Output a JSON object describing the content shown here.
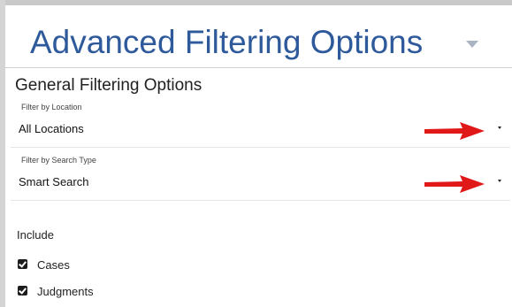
{
  "header": {
    "title": "Advanced Filtering Options",
    "caret_icon": "chevron-down-icon"
  },
  "general": {
    "section_title": "General Filtering Options",
    "location": {
      "label": "Filter by Location",
      "value": "All Locations"
    },
    "search_type": {
      "label": "Filter by Search Type",
      "value": "Smart Search"
    }
  },
  "include": {
    "label": "Include",
    "options": [
      {
        "label": "Cases",
        "checked": true
      },
      {
        "label": "Judgments",
        "checked": true
      }
    ]
  },
  "annotation": {
    "arrow_color": "#e01818"
  },
  "colors": {
    "title": "#2e5a9b"
  }
}
